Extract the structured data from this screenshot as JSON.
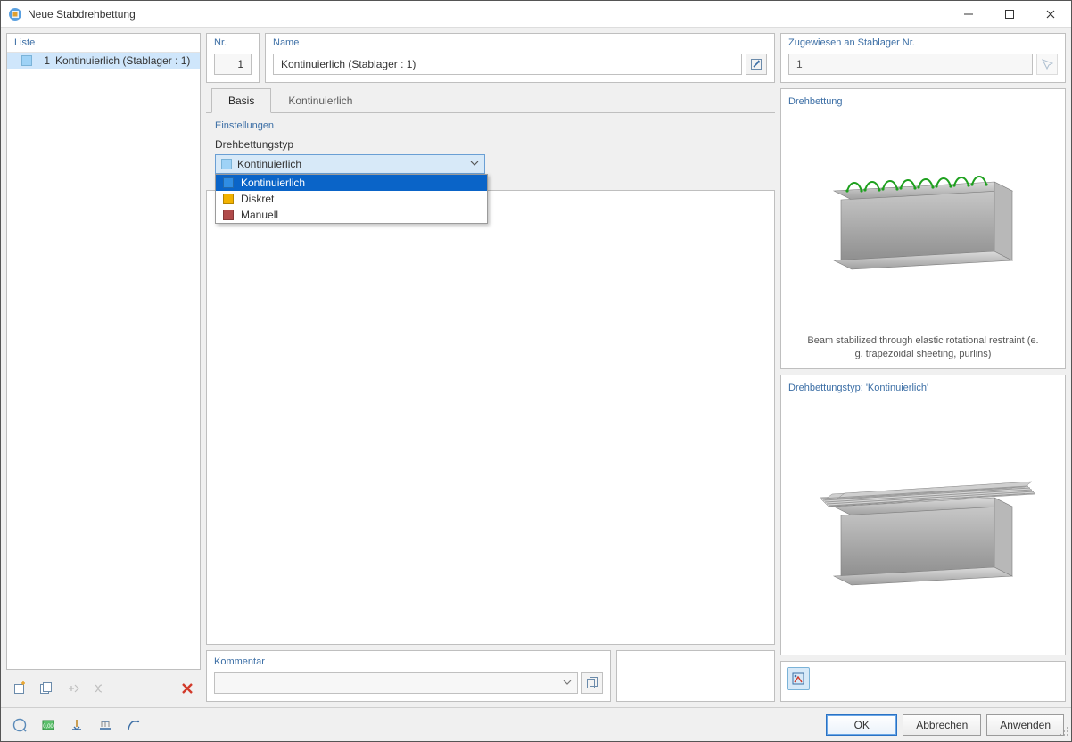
{
  "window": {
    "title": "Neue Stabdrehbettung"
  },
  "left": {
    "header": "Liste",
    "item_num": "1",
    "item_label": "Kontinuierlich (Stablager : 1)"
  },
  "header": {
    "nr_label": "Nr.",
    "nr_value": "1",
    "name_label": "Name",
    "name_value": "Kontinuierlich (Stablager : 1)",
    "assign_label": "Zugewiesen an Stablager Nr.",
    "assign_value": "1"
  },
  "tabs": {
    "basis": "Basis",
    "kont": "Kontinuierlich"
  },
  "settings": {
    "section": "Einstellungen",
    "type_label": "Drehbettungstyp",
    "selected": "Kontinuierlich",
    "options": {
      "o0": {
        "label": "Kontinuierlich",
        "color": "#2f8de4"
      },
      "o1": {
        "label": "Diskret",
        "color": "#f2b200"
      },
      "o2": {
        "label": "Manuell",
        "color": "#b04a4a"
      }
    }
  },
  "preview": {
    "title1": "Drehbettung",
    "caption1": "Beam stabilized through elastic rotational restraint (e. g. trapezoidal sheeting, purlins)",
    "title2": "Drehbettungstyp: 'Kontinuierlich'"
  },
  "comment": {
    "label": "Kommentar"
  },
  "footer": {
    "ok": "OK",
    "cancel": "Abbrechen",
    "apply": "Anwenden"
  }
}
